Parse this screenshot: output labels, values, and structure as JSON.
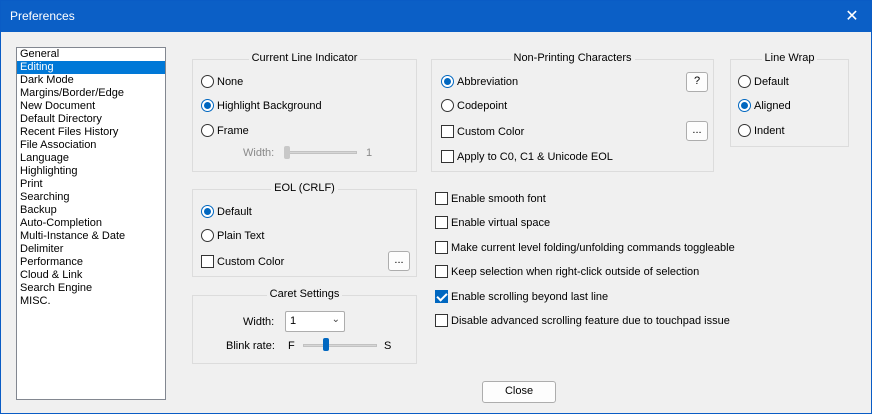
{
  "window": {
    "title": "Preferences",
    "close_glyph": "✕"
  },
  "categories": [
    "General",
    "Editing",
    "Dark Mode",
    "Margins/Border/Edge",
    "New Document",
    "Default Directory",
    "Recent Files History",
    "File Association",
    "Language",
    "Highlighting",
    "Print",
    "Searching",
    "Backup",
    "Auto-Completion",
    "Multi-Instance & Date",
    "Delimiter",
    "Performance",
    "Cloud & Link",
    "Search Engine",
    "MISC."
  ],
  "selected_category": "Editing",
  "current_line": {
    "title": "Current Line Indicator",
    "none": "None",
    "highlight": "Highlight Background",
    "frame": "Frame",
    "selected": "Highlight Background",
    "width_label": "Width:",
    "width_value": "1"
  },
  "eol": {
    "title": "EOL (CRLF)",
    "default": "Default",
    "plain": "Plain Text",
    "selected": "Default",
    "custom_color": "Custom Color",
    "custom_checked": false,
    "more": "..."
  },
  "caret": {
    "title": "Caret Settings",
    "width_label": "Width:",
    "width_value": "1",
    "blink_label": "Blink rate:",
    "blink_fast": "F",
    "blink_slow": "S",
    "blink_level": 0.3
  },
  "non_printing": {
    "title": "Non-Printing Characters",
    "abbreviation": "Abbreviation",
    "codepoint": "Codepoint",
    "selected": "Abbreviation",
    "help": "?",
    "custom_color": "Custom Color",
    "custom_checked": false,
    "more": "...",
    "apply": "Apply to C0, C1 & Unicode EOL",
    "apply_checked": false
  },
  "line_wrap": {
    "title": "Line Wrap",
    "default": "Default",
    "aligned": "Aligned",
    "indent": "Indent",
    "selected": "Aligned"
  },
  "options": [
    {
      "label": "Enable smooth font",
      "checked": false
    },
    {
      "label": "Enable virtual space",
      "checked": false
    },
    {
      "label": "Make current level folding/unfolding commands toggleable",
      "checked": false
    },
    {
      "label": "Keep selection when right-click outside of selection",
      "checked": false
    },
    {
      "label": "Enable scrolling beyond last line",
      "checked": true
    },
    {
      "label": "Disable advanced scrolling feature due to touchpad issue",
      "checked": false
    }
  ],
  "close_label": "Close",
  "colors": {
    "titlebar": "#0b5fc6",
    "selection": "#0078d7",
    "accent": "#0067c0"
  }
}
